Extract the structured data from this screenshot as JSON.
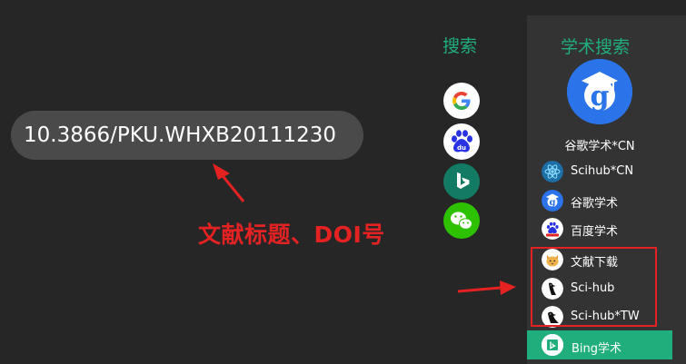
{
  "search": {
    "value": "10.3866/PKU.WHXB20111230"
  },
  "annotation": {
    "text": "文献标题、DOI号"
  },
  "search_column": {
    "title": "搜索",
    "engines": [
      {
        "icon": "google-icon"
      },
      {
        "icon": "baidu-icon"
      },
      {
        "icon": "bing-icon"
      },
      {
        "icon": "wechat-icon"
      }
    ]
  },
  "scholar_panel": {
    "title": "学术搜索",
    "featured": {
      "icon": "google-scholar-icon",
      "label": "谷歌学术*CN"
    },
    "items": [
      {
        "icon": "scihub-atom-icon",
        "label": "Scihub*CN"
      },
      {
        "icon": "google-scholar-icon",
        "label": "谷歌学术"
      },
      {
        "icon": "baidu-scholar-icon",
        "label": "百度学术"
      },
      {
        "icon": "cat-icon",
        "label": "文献下载"
      },
      {
        "icon": "raven-icon",
        "label": "Sci-hub"
      },
      {
        "icon": "raven-icon",
        "label": "Sci-hub*TW"
      }
    ],
    "active": {
      "icon": "bing-scholar-icon",
      "label": "Bing学术"
    }
  },
  "colors": {
    "background": "#262626",
    "panel": "#333333",
    "accent_green": "#1fae7c",
    "annotation_red": "#e42222",
    "input_bg": "#4a4a4a"
  }
}
